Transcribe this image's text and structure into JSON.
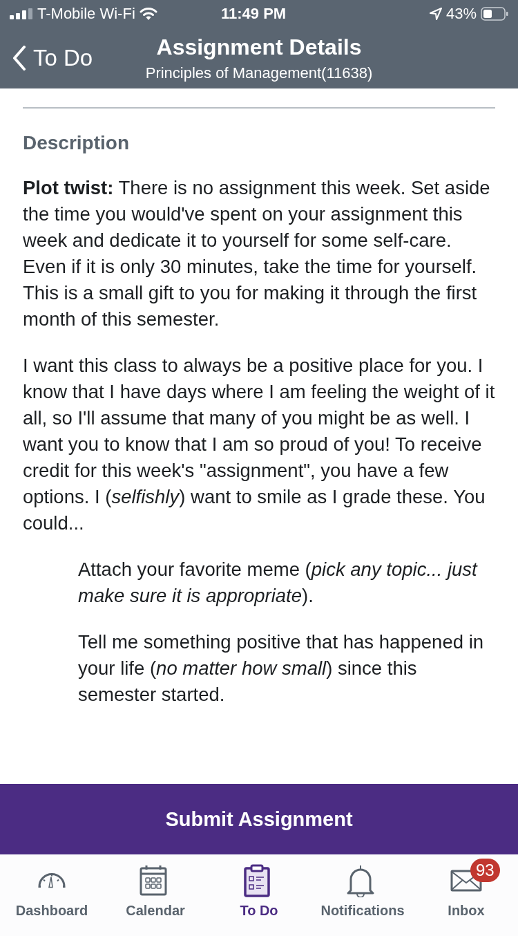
{
  "status_bar": {
    "carrier": "T-Mobile Wi-Fi",
    "time": "11:49 PM",
    "battery": "43%"
  },
  "nav_bar": {
    "back": "To Do",
    "title": "Assignment Details",
    "subtitle": "Principles of Management(11638)"
  },
  "section_title": "Description",
  "paragraphs": [
    "**Plot twist:** There is no assignment this week. Set aside the time you would've spent on your assignment this week and dedicate it to yourself for some self-care. Even if it is only 30 minutes, take the time for yourself. This is a small gift to you for making it through the first month of this semester.",
    "I want this class to always be a positive place for you. I know that I have days where I am feeling the weight of it all, so I'll assume that many of you might be as well. I want you to know that I am so proud of you! To receive credit for this week's \"assignment\", you have a few options. I (*selfishly*) want to smile as I grade these. You could..."
  ],
  "options": [
    "Attach your favorite meme (*pick any topic... just make sure it is appropriate*).",
    "Tell me something positive that has happened in your life (*no matter how small*) since this semester started."
  ],
  "submit_button": "Submit Assignment",
  "tab_bar": [
    {
      "kind": "dashboard",
      "label": "Dashboard",
      "selected": false
    },
    {
      "kind": "calendar",
      "label": "Calendar",
      "selected": false
    },
    {
      "kind": "todo",
      "label": "To Do",
      "selected": true
    },
    {
      "kind": "notifications",
      "label": "Notifications",
      "selected": false
    },
    {
      "kind": "inbox",
      "label": "Inbox",
      "selected": false,
      "badge": "93"
    }
  ]
}
